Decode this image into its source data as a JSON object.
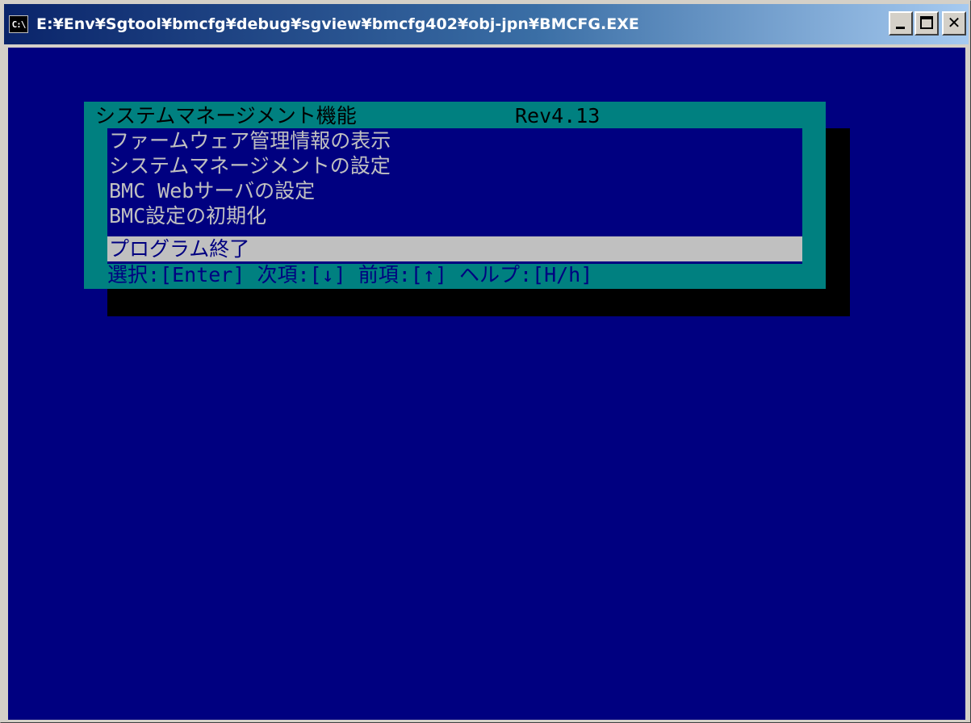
{
  "window": {
    "title": "E:¥Env¥Sgtool¥bmcfg¥debug¥sgview¥bmcfg402¥obj-jpn¥BMCFG.EXE",
    "icon_label": "C:\\",
    "icon": "console-window-icon",
    "controls": {
      "minimize_icon": "minimize-icon",
      "maximize_icon": "maximize-icon",
      "close_icon": "close-icon",
      "close_label": "✕"
    }
  },
  "dialog": {
    "title": "システムマネージメント機能",
    "revision": "Rev4.13",
    "menu_items": [
      {
        "label": "ファームウェア管理情報の表示",
        "selected": false
      },
      {
        "label": "システムマネージメントの設定",
        "selected": false
      },
      {
        "label": "BMC Webサーバの設定",
        "selected": false
      },
      {
        "label": "BMC設定の初期化",
        "selected": false
      },
      {
        "label": "プログラム終了",
        "selected": true
      }
    ],
    "help_line": "選択:[Enter] 次項:[↓] 前項:[↑] ヘルプ:[H/h]"
  },
  "colors": {
    "console_background": "#000080",
    "frame": "#008080",
    "menu_text": "#c0c0c0",
    "selection_background": "#c0c0c0",
    "selection_text": "#000080",
    "shadow": "#000000",
    "title_bar_start": "#0a246a",
    "title_bar_end": "#a6caf0"
  }
}
